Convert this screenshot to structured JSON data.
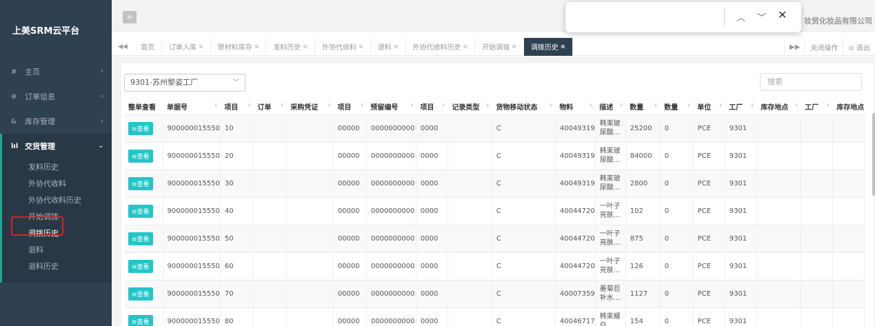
{
  "brand": "上美SRM云平台",
  "company": "妆贸化妆品有限公司",
  "nav": [
    {
      "icon": "#",
      "label": "主页"
    },
    {
      "icon": "⊕",
      "label": "订单信息"
    },
    {
      "icon": "&",
      "label": "库存管理"
    }
  ],
  "nav_group": {
    "icon": "lıl",
    "label": "交货管理",
    "items": [
      "发料历史",
      "外协代收料",
      "外协代收料历史",
      "开始调拨",
      "调拨历史",
      "退料",
      "退料历史"
    ]
  },
  "tabs": [
    "首页",
    "订单入库",
    "原材料库存",
    "发料历史",
    "外协代收料",
    "退料",
    "外协代收料历史",
    "开始调拨",
    "调拨历史"
  ],
  "tabs_right": {
    "close_ops": "关闭操作",
    "logout": "⊖ 退出"
  },
  "filter": {
    "plant": "9301-苏州黎姿工厂",
    "search_placeholder": "搜索"
  },
  "columns": [
    "整单查看",
    "单据号",
    "项目",
    "订单",
    "采购凭证",
    "项目",
    "预留编号",
    "项目",
    "记录类型",
    "货物移动状态",
    "物料",
    "描述",
    "数量",
    "数量",
    "单位",
    "工厂",
    "库存地点",
    "工厂",
    "库存地点"
  ],
  "view_label": "≡查看",
  "rows": [
    {
      "doc": "900000015550",
      "item": "10",
      "item2": "00000",
      "reserve": "0000000000",
      "item3": "0000",
      "status": "C",
      "material": "40049319",
      "desc": "韩束玻尿酸...",
      "qty": "25200",
      "qty2": "0",
      "unit": "PCE",
      "plant": "9301"
    },
    {
      "doc": "900000015550",
      "item": "20",
      "item2": "00000",
      "reserve": "0000000000",
      "item3": "0000",
      "status": "C",
      "material": "40049319",
      "desc": "韩束玻尿酸...",
      "qty": "84000",
      "qty2": "0",
      "unit": "PCE",
      "plant": "9301"
    },
    {
      "doc": "900000015550",
      "item": "30",
      "item2": "00000",
      "reserve": "0000000000",
      "item3": "0000",
      "status": "C",
      "material": "40049319",
      "desc": "韩束玻尿酸...",
      "qty": "2800",
      "qty2": "0",
      "unit": "PCE",
      "plant": "9301"
    },
    {
      "doc": "900000015550",
      "item": "40",
      "item2": "00000",
      "reserve": "0000000000",
      "item3": "0000",
      "status": "C",
      "material": "40044720",
      "desc": "一叶子亮肤...",
      "qty": "102",
      "qty2": "0",
      "unit": "PCE",
      "plant": "9301"
    },
    {
      "doc": "900000015550",
      "item": "50",
      "item2": "00000",
      "reserve": "0000000000",
      "item3": "0000",
      "status": "C",
      "material": "40044720",
      "desc": "一叶子亮肤...",
      "qty": "875",
      "qty2": "0",
      "unit": "PCE",
      "plant": "9301"
    },
    {
      "doc": "900000015550",
      "item": "60",
      "item2": "00000",
      "reserve": "0000000000",
      "item3": "0000",
      "status": "C",
      "material": "40044720",
      "desc": "一叶子亮肤...",
      "qty": "126",
      "qty2": "0",
      "unit": "PCE",
      "plant": "9301"
    },
    {
      "doc": "900000015550",
      "item": "70",
      "item2": "00000",
      "reserve": "0000000000",
      "item3": "0000",
      "status": "C",
      "material": "40007359",
      "desc": "墨菊巨补水...",
      "qty": "1127",
      "qty2": "0",
      "unit": "PCE",
      "plant": "9301"
    },
    {
      "doc": "900000015550",
      "item": "80",
      "item2": "00000",
      "reserve": "0000000000",
      "item3": "0000",
      "status": "C",
      "material": "40046717",
      "desc": "韩束耀白...",
      "qty": "154",
      "qty2": "0",
      "unit": "PCE",
      "plant": "9301"
    }
  ]
}
